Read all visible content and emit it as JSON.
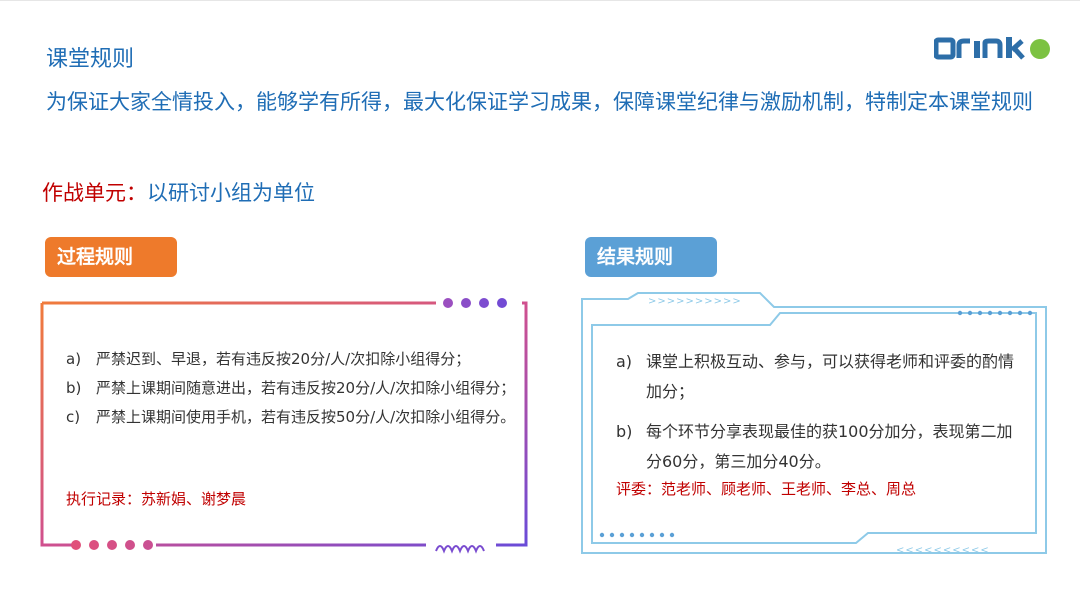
{
  "header": {
    "title": "课堂规则",
    "intro": "为保证大家全情投入，能够学有所得，最大化保证学习成果，保障课堂纪律与激励机制，特制定本课堂规则",
    "logo_text": "orinko"
  },
  "unit": {
    "label": "作战单元：",
    "value": "以研讨小组为单位"
  },
  "process_rules": {
    "title": "过程规则",
    "items": [
      {
        "marker": "a)",
        "text": "严禁迟到、早退，若有违反按20分/人/次扣除小组得分；"
      },
      {
        "marker": "b)",
        "text": "严禁上课期间随意进出，若有违反按20分/人/次扣除小组得分；"
      },
      {
        "marker": "c)",
        "text": "严禁上课期间使用手机，若有违反按50分/人/次扣除小组得分。"
      }
    ],
    "record": "执行记录：苏新娟、谢梦晨"
  },
  "result_rules": {
    "title": "结果规则",
    "items": [
      {
        "marker": "a)",
        "text": "课堂上积极互动、参与，可以获得老师和评委的酌情加分；"
      },
      {
        "marker": "b)",
        "text": "每个环节分享表现最佳的获100分加分，表现第二加分60分，第三加分40分。"
      }
    ],
    "judges": "评委：范老师、顾老师、王老师、李总、周总"
  },
  "colors": {
    "title_blue": "#1f6db5",
    "red": "#c00000",
    "orange": "#ee7a2b",
    "light_blue": "#5ba0d6",
    "frame_blue": "#8ecae8",
    "logo_blue": "#2d6ea8",
    "logo_green": "#7cc242"
  }
}
